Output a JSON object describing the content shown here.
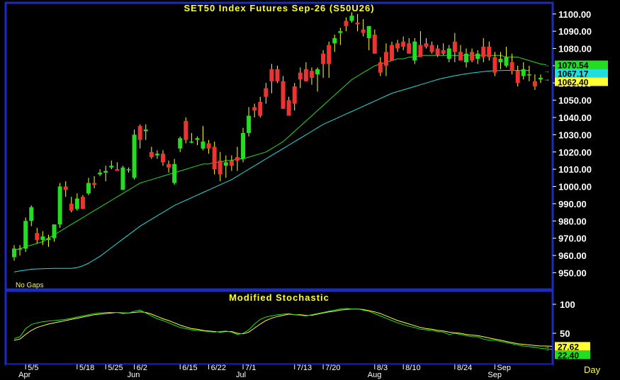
{
  "chart_data": [
    {
      "type": "candlestick",
      "title": "SET50  Index  Futures  Sep-26  (S50U26)",
      "note": "No  Gaps",
      "ylim": [
        944,
        1104
      ],
      "y_ticks": [
        "1100.00",
        "1090.00",
        "1080.00",
        "1070.00",
        "1060.00",
        "1050.00",
        "1040.00",
        "1030.00",
        "1020.00",
        "1010.00",
        "1000.00",
        "990.00",
        "980.00",
        "970.00",
        "960.00",
        "950.00"
      ],
      "y_tick_values": [
        1100,
        1090,
        1080,
        1070,
        1060,
        1050,
        1040,
        1030,
        1020,
        1010,
        1000,
        990,
        980,
        970,
        960,
        950
      ],
      "last_values": [
        {
          "label": "1070.54",
          "value": 1070.54,
          "color": "#22dd22",
          "series": "green-ma"
        },
        {
          "label": "1067.17",
          "value": 1067.17,
          "color": "#22dddd",
          "series": "cyan-ma"
        },
        {
          "label": "1062.40",
          "value": 1062.4,
          "color": "#ffff33",
          "series": "close"
        }
      ],
      "candles": [
        [
          959,
          966,
          957,
          964
        ],
        [
          964,
          966,
          960,
          964
        ],
        [
          964,
          982,
          962,
          980
        ],
        [
          980,
          989,
          977,
          988
        ],
        [
          973,
          976,
          967,
          969
        ],
        [
          969,
          974,
          966,
          971
        ],
        [
          969,
          972,
          965,
          970
        ],
        [
          970,
          978,
          968,
          978
        ],
        [
          978,
          1002,
          976,
          1000
        ],
        [
          1000,
          1003,
          994,
          998
        ],
        [
          990,
          994,
          985,
          986
        ],
        [
          987,
          996,
          986,
          993
        ],
        [
          994,
          995,
          987,
          987
        ],
        [
          996,
          1005,
          995,
          1002
        ],
        [
          1002,
          1006,
          999,
          1001
        ],
        [
          1007,
          1010,
          1006,
          1008
        ],
        [
          1008,
          1012,
          1003,
          1009
        ],
        [
          1011,
          1015,
          1010,
          1012
        ],
        [
          1010,
          1014,
          1009,
          1009
        ],
        [
          998,
          1012,
          998,
          1011
        ],
        [
          1010,
          1011,
          1008,
          1010
        ],
        [
          1005,
          1033,
          1004,
          1030
        ],
        [
          1035,
          1036,
          1022,
          1027
        ],
        [
          1032,
          1036,
          1027,
          1033
        ],
        [
          1020,
          1023,
          1016,
          1017
        ],
        [
          1018,
          1021,
          1016,
          1019
        ],
        [
          1019,
          1021,
          1012,
          1014
        ],
        [
          1013,
          1015,
          1008,
          1011
        ],
        [
          1002,
          1016,
          1001,
          1013
        ],
        [
          1022,
          1029,
          1020,
          1028
        ],
        [
          1038,
          1040,
          1025,
          1027
        ],
        [
          1026,
          1031,
          1025,
          1026
        ],
        [
          1027,
          1029,
          1024,
          1028
        ],
        [
          1022,
          1035,
          1021,
          1026
        ],
        [
          1025,
          1027,
          1019,
          1022
        ],
        [
          1023,
          1026,
          1007,
          1010
        ],
        [
          1015,
          1020,
          1003,
          1007
        ],
        [
          1012,
          1018,
          1005,
          1014
        ],
        [
          1015,
          1018,
          1009,
          1012
        ],
        [
          1017,
          1023,
          1009,
          1015
        ],
        [
          1016,
          1034,
          1014,
          1031
        ],
        [
          1031,
          1046,
          1029,
          1041
        ],
        [
          1046,
          1048,
          1040,
          1044
        ],
        [
          1049,
          1052,
          1040,
          1041
        ],
        [
          1057,
          1060,
          1048,
          1052
        ],
        [
          1068,
          1071,
          1054,
          1061
        ],
        [
          1068,
          1070,
          1060,
          1061
        ],
        [
          1061,
          1064,
          1046,
          1045
        ],
        [
          1050,
          1052,
          1043,
          1041
        ],
        [
          1058,
          1060,
          1044,
          1048
        ],
        [
          1066,
          1069,
          1057,
          1062
        ],
        [
          1068,
          1072,
          1061,
          1061
        ],
        [
          1067,
          1069,
          1059,
          1063
        ],
        [
          1065,
          1069,
          1055,
          1068
        ],
        [
          1077,
          1079,
          1063,
          1071
        ],
        [
          1082,
          1084,
          1063,
          1071
        ],
        [
          1083,
          1088,
          1078,
          1086
        ],
        [
          1089,
          1092,
          1082,
          1090
        ],
        [
          1096,
          1098,
          1090,
          1093
        ],
        [
          1096,
          1101,
          1095,
          1099
        ],
        [
          1095,
          1100,
          1090,
          1094
        ],
        [
          1091,
          1097,
          1087,
          1089
        ],
        [
          1086,
          1093,
          1079,
          1093
        ],
        [
          1088,
          1091,
          1083,
          1077
        ],
        [
          1072,
          1075,
          1064,
          1066
        ],
        [
          1078,
          1083,
          1064,
          1070
        ],
        [
          1082,
          1084,
          1074,
          1073
        ],
        [
          1083,
          1085,
          1078,
          1080
        ],
        [
          1084,
          1087,
          1079,
          1081
        ],
        [
          1083,
          1086,
          1078,
          1077
        ],
        [
          1073,
          1086,
          1071,
          1084
        ],
        [
          1082,
          1090,
          1077,
          1075
        ],
        [
          1083,
          1086,
          1080,
          1081
        ],
        [
          1082,
          1084,
          1077,
          1078
        ],
        [
          1080,
          1082,
          1075,
          1076
        ],
        [
          1079,
          1083,
          1076,
          1077
        ],
        [
          1074,
          1082,
          1072,
          1080
        ],
        [
          1084,
          1089,
          1072,
          1078
        ],
        [
          1078,
          1082,
          1074,
          1073
        ],
        [
          1072,
          1080,
          1069,
          1077
        ],
        [
          1078,
          1080,
          1072,
          1073
        ],
        [
          1074,
          1079,
          1071,
          1077
        ],
        [
          1081,
          1086,
          1072,
          1075
        ],
        [
          1081,
          1084,
          1073,
          1075
        ],
        [
          1075,
          1078,
          1064,
          1066
        ],
        [
          1072,
          1078,
          1068,
          1074
        ],
        [
          1070,
          1081,
          1069,
          1075
        ],
        [
          1072,
          1077,
          1065,
          1067
        ],
        [
          1067,
          1070,
          1058,
          1060
        ],
        [
          1064,
          1072,
          1062,
          1068
        ],
        [
          1065,
          1070,
          1061,
          1065
        ],
        [
          1061,
          1065,
          1056,
          1058
        ],
        [
          1062,
          1065,
          1060,
          1063
        ]
      ],
      "green_ma": [
        963,
        964,
        965,
        966,
        967,
        968,
        970,
        972,
        974,
        976,
        978,
        980,
        982,
        984,
        986,
        988,
        990,
        992,
        994,
        996,
        998,
        1000,
        1002,
        1003,
        1004,
        1005,
        1006,
        1007,
        1008,
        1009,
        1010,
        1011,
        1012,
        1013,
        1013,
        1014,
        1014,
        1015,
        1015,
        1016,
        1016,
        1017,
        1018,
        1019,
        1020,
        1022,
        1024,
        1026,
        1029,
        1032,
        1035,
        1038,
        1041,
        1044,
        1047,
        1050,
        1053,
        1056,
        1059,
        1062,
        1064,
        1066,
        1068,
        1070,
        1071,
        1072,
        1073,
        1074,
        1074,
        1075,
        1075,
        1076,
        1076,
        1076,
        1076,
        1076,
        1076,
        1076,
        1076,
        1076,
        1076,
        1076,
        1076,
        1076,
        1076,
        1076,
        1075,
        1075,
        1075,
        1074,
        1073,
        1072,
        1071,
        1070.54
      ],
      "cyan_ma": [
        950.5,
        951,
        951.5,
        952,
        952.2,
        952.3,
        952.4,
        952.5,
        952.5,
        952.5,
        952.5,
        953,
        954,
        955.5,
        957.5,
        959.5,
        962,
        964.5,
        967,
        969.5,
        972,
        974.5,
        977,
        979,
        981,
        983,
        985,
        987,
        989,
        990.5,
        992,
        993.5,
        995,
        996.5,
        998,
        999.5,
        1001,
        1002.5,
        1004,
        1006,
        1008,
        1010,
        1012,
        1014,
        1016,
        1018,
        1020,
        1022,
        1024,
        1026,
        1028,
        1030,
        1032,
        1034,
        1036,
        1037.5,
        1039,
        1040.5,
        1042,
        1043.5,
        1045,
        1046.5,
        1048,
        1049.5,
        1051,
        1052.5,
        1054,
        1055,
        1056,
        1057,
        1058,
        1059,
        1060,
        1061,
        1062,
        1062.8,
        1063.5,
        1064.2,
        1064.8,
        1065.3,
        1065.8,
        1066.2,
        1066.6,
        1066.9,
        1067.1,
        1067.2,
        1067.3,
        1067.3,
        1067.2,
        1067.2,
        1067.17
      ]
    },
    {
      "type": "line",
      "title": "Modified  Stochastic",
      "ylim": [
        0,
        100
      ],
      "y_ticks": [
        "100",
        "50"
      ],
      "y_tick_values": [
        100,
        50
      ],
      "x_unit": "Day",
      "last_values": [
        {
          "label": "27.62",
          "value": 27.62,
          "color": "#ffff33",
          "series": "slow"
        },
        {
          "label": "22.40",
          "value": 22.4,
          "color": "#22dd22",
          "series": "fast"
        }
      ],
      "fast": [
        41,
        44,
        58,
        65,
        68,
        70,
        71,
        72,
        73,
        74,
        76,
        78,
        80,
        82,
        84,
        85,
        86,
        86,
        86,
        84,
        85,
        88,
        90,
        85,
        80,
        75,
        72,
        68,
        64,
        60,
        58,
        56,
        55,
        54,
        53,
        52,
        53,
        54,
        52,
        48,
        50,
        56,
        66,
        74,
        78,
        80,
        82,
        83,
        84,
        82,
        81,
        80,
        82,
        84,
        86,
        88,
        90,
        92,
        93,
        92,
        92,
        90,
        88,
        84,
        80,
        76,
        72,
        68,
        65,
        62,
        60,
        57,
        56,
        55,
        53,
        52,
        48,
        50,
        48,
        46,
        44,
        44,
        40,
        38,
        38,
        36,
        34,
        32,
        30,
        28,
        27,
        26,
        24,
        23,
        22.4
      ],
      "slow": [
        38,
        40,
        48,
        55,
        60,
        63,
        66,
        68,
        70,
        72,
        74,
        76,
        78,
        80,
        82,
        83,
        84,
        85,
        86,
        85,
        85,
        86,
        87,
        86,
        83,
        79,
        75,
        72,
        68,
        64,
        61,
        58,
        57,
        55,
        54,
        53,
        52,
        53,
        53,
        50,
        49,
        52,
        59,
        66,
        72,
        76,
        79,
        81,
        83,
        82,
        82,
        81,
        81,
        83,
        85,
        87,
        88,
        90,
        91,
        92,
        92,
        91,
        89,
        87,
        84,
        80,
        76,
        72,
        69,
        66,
        63,
        60,
        58,
        57,
        55,
        54,
        52,
        51,
        50,
        48,
        47,
        46,
        44,
        42,
        40,
        38,
        36,
        34,
        32,
        31,
        30,
        29,
        28,
        28,
        27.62
      ]
    }
  ],
  "x_axis": {
    "tick_labels": [
      {
        "label": "5/5",
        "index": 2
      },
      {
        "label": "5/18",
        "index": 11
      },
      {
        "label": "5/25",
        "index": 16
      },
      {
        "label": "6/2",
        "index": 21
      },
      {
        "label": "6/15",
        "index": 29
      },
      {
        "label": "6/22",
        "index": 34
      },
      {
        "label": "7/1",
        "index": 40
      },
      {
        "label": "7/13",
        "index": 49
      },
      {
        "label": "7/20",
        "index": 54
      },
      {
        "label": "8/3",
        "index": 63
      },
      {
        "label": "8/10",
        "index": 68
      },
      {
        "label": "8/24",
        "index": 77
      },
      {
        "label": "Sep",
        "index": 84
      }
    ],
    "month_labels": [
      {
        "label": "Apr",
        "index": 2
      },
      {
        "label": "Jun",
        "index": 21
      },
      {
        "label": "Jul",
        "index": 40
      },
      {
        "label": "Aug",
        "index": 63
      },
      {
        "label": "Sep",
        "index": 84
      }
    ]
  },
  "colors": {
    "up": "#22dd22",
    "down": "#ee3333",
    "wick": "#ffff33",
    "frame": "#1c2bc2",
    "background": "#000000"
  }
}
